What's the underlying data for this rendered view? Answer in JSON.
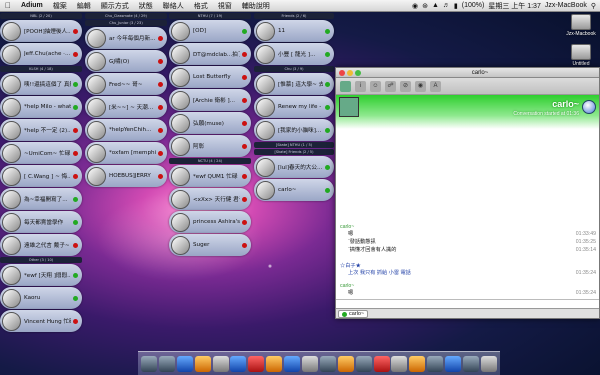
{
  "menubar": {
    "items": [
      "Adium",
      "檔案",
      "編輯",
      "顯示方式",
      "狀態",
      "聯絡人",
      "格式",
      "視窗",
      "輔助說明"
    ],
    "battery": "(100%)",
    "clock": "星期三 上午 1:37",
    "user": "Jzx-MacBook"
  },
  "desktop": {
    "icons": [
      "Jzx-Macbook",
      "Untitled"
    ]
  },
  "contacts": {
    "col1": [
      {
        "header": "NBL (2 / 20)",
        "items": [
          {
            "name": "[POOH]抽煙後人...",
            "status": "red"
          },
          {
            "name": "Jeff.Chu(ache ·...",
            "status": "red"
          }
        ]
      },
      {
        "header": "KLSH (4 / 18)",
        "items": [
          {
            "name": "咦!!還搞這個了 真夠lo...",
            "status": "green"
          },
          {
            "name": "*help Milo - what if...",
            "status": "green"
          },
          {
            "name": "*help 不一定 (2)...",
            "status": "red"
          },
          {
            "name": "~UmiCom~ 忙碌",
            "status": "red"
          },
          {
            "name": "[ C.Wang ] ~ 悔...",
            "status": "red"
          }
        ]
      },
      {
        "header": "",
        "items": [
          {
            "name": "為~幸福開寫了...",
            "status": "green"
          },
          {
            "name": "每天都賣當學作",
            "status": "green"
          },
          {
            "name": "遠雄之代言 戴子~",
            "status": "red"
          }
        ]
      },
      {
        "header": "Other (3 / 10)",
        "items": [
          {
            "name": "*ewf [天翔 ]悶悶...",
            "status": "green"
          },
          {
            "name": "Kaoru",
            "status": "green"
          },
          {
            "name": "Vincent Hung 忙碌",
            "status": "red"
          }
        ]
      }
    ],
    "col2": [
      {
        "header": "Chu_Classmate (4 / 29)",
        "items": []
      },
      {
        "header": "Chu_Junior (3 / 23)",
        "items": [
          {
            "name": "ar 今年每個月新...",
            "status": "red"
          },
          {
            "name": "GJ嘯(O)",
            "status": "red"
          },
          {
            "name": "Fred~~ 哥~",
            "status": "red"
          },
          {
            "name": "[米~~] ~ 天潮...",
            "status": "red"
          },
          {
            "name": "*helpYenChih...",
            "status": "red"
          },
          {
            "name": "*oxfam [memphis]",
            "status": "red"
          },
          {
            "name": "HOEBUS]JERRY",
            "status": "red"
          }
        ]
      }
    ],
    "col3": [
      {
        "header": "NTHU (7 / 19)",
        "items": [
          {
            "name": "[OD]",
            "status": "green"
          },
          {
            "name": "DT@mdclab...拍了...",
            "status": "red"
          },
          {
            "name": "Lost Butterfly",
            "status": "red"
          },
          {
            "name": "[Archie 衛彬 ]...",
            "status": "red"
          },
          {
            "name": "弘願(muse)",
            "status": "red"
          },
          {
            "name": "阿彰",
            "status": "red"
          }
        ]
      },
      {
        "header": "NCTU (4 / 24)",
        "items": [
          {
            "name": "*ewf QUM1 忙碌",
            "status": "red"
          },
          {
            "name": "<xXx> 天行健 君子...",
            "status": "red"
          },
          {
            "name": "princess Ashira's...",
            "status": "red"
          },
          {
            "name": "Suger",
            "status": "red"
          }
        ]
      }
    ],
    "col4": [
      {
        "header": "Friends (2 / 6)",
        "items": [
          {
            "name": "11",
            "status": "green"
          },
          {
            "name": "小豐 [ 龍光 ]...",
            "status": "green"
          }
        ]
      },
      {
        "header": "Chu (3 / 9)",
        "items": [
          {
            "name": "[惟慕] 這大學~ 去...",
            "status": "green"
          },
          {
            "name": "Renew my life - ...",
            "status": "green"
          },
          {
            "name": "[我家的小貓咪]...",
            "status": "green"
          }
        ]
      },
      {
        "header": "[Skate] NTHU (1 / 5)",
        "items": []
      },
      {
        "header": "[Skate] Friends (2 / 5)",
        "items": [
          {
            "name": "[lul]春天的大公...",
            "status": "green"
          },
          {
            "name": "carlo~",
            "status": "green"
          }
        ]
      }
    ]
  },
  "chat": {
    "title": "carlo~",
    "contact": "carlo~",
    "subtitle": "Conversation started at 01:36",
    "messages": [
      {
        "sender": "carlo~",
        "sender_color": "green",
        "lines": [
          {
            "text": "嗯",
            "time": "01:33:49"
          },
          {
            "text": "¨發話動態訊",
            "time": "01:35:25"
          },
          {
            "text": "¨搞懂才回會有人識的",
            "time": "01:35:14"
          }
        ]
      },
      {
        "sender": "☆白子★",
        "sender_color": "blue",
        "lines": [
          {
            "text": "上次 我只有 抓給 小雷 電話",
            "time": "01:35:24"
          }
        ]
      },
      {
        "sender": "carlo~",
        "sender_color": "green",
        "lines": [
          {
            "text": "嗯",
            "time": "01:35:24"
          }
        ]
      }
    ],
    "tab_label": "carlo~"
  }
}
